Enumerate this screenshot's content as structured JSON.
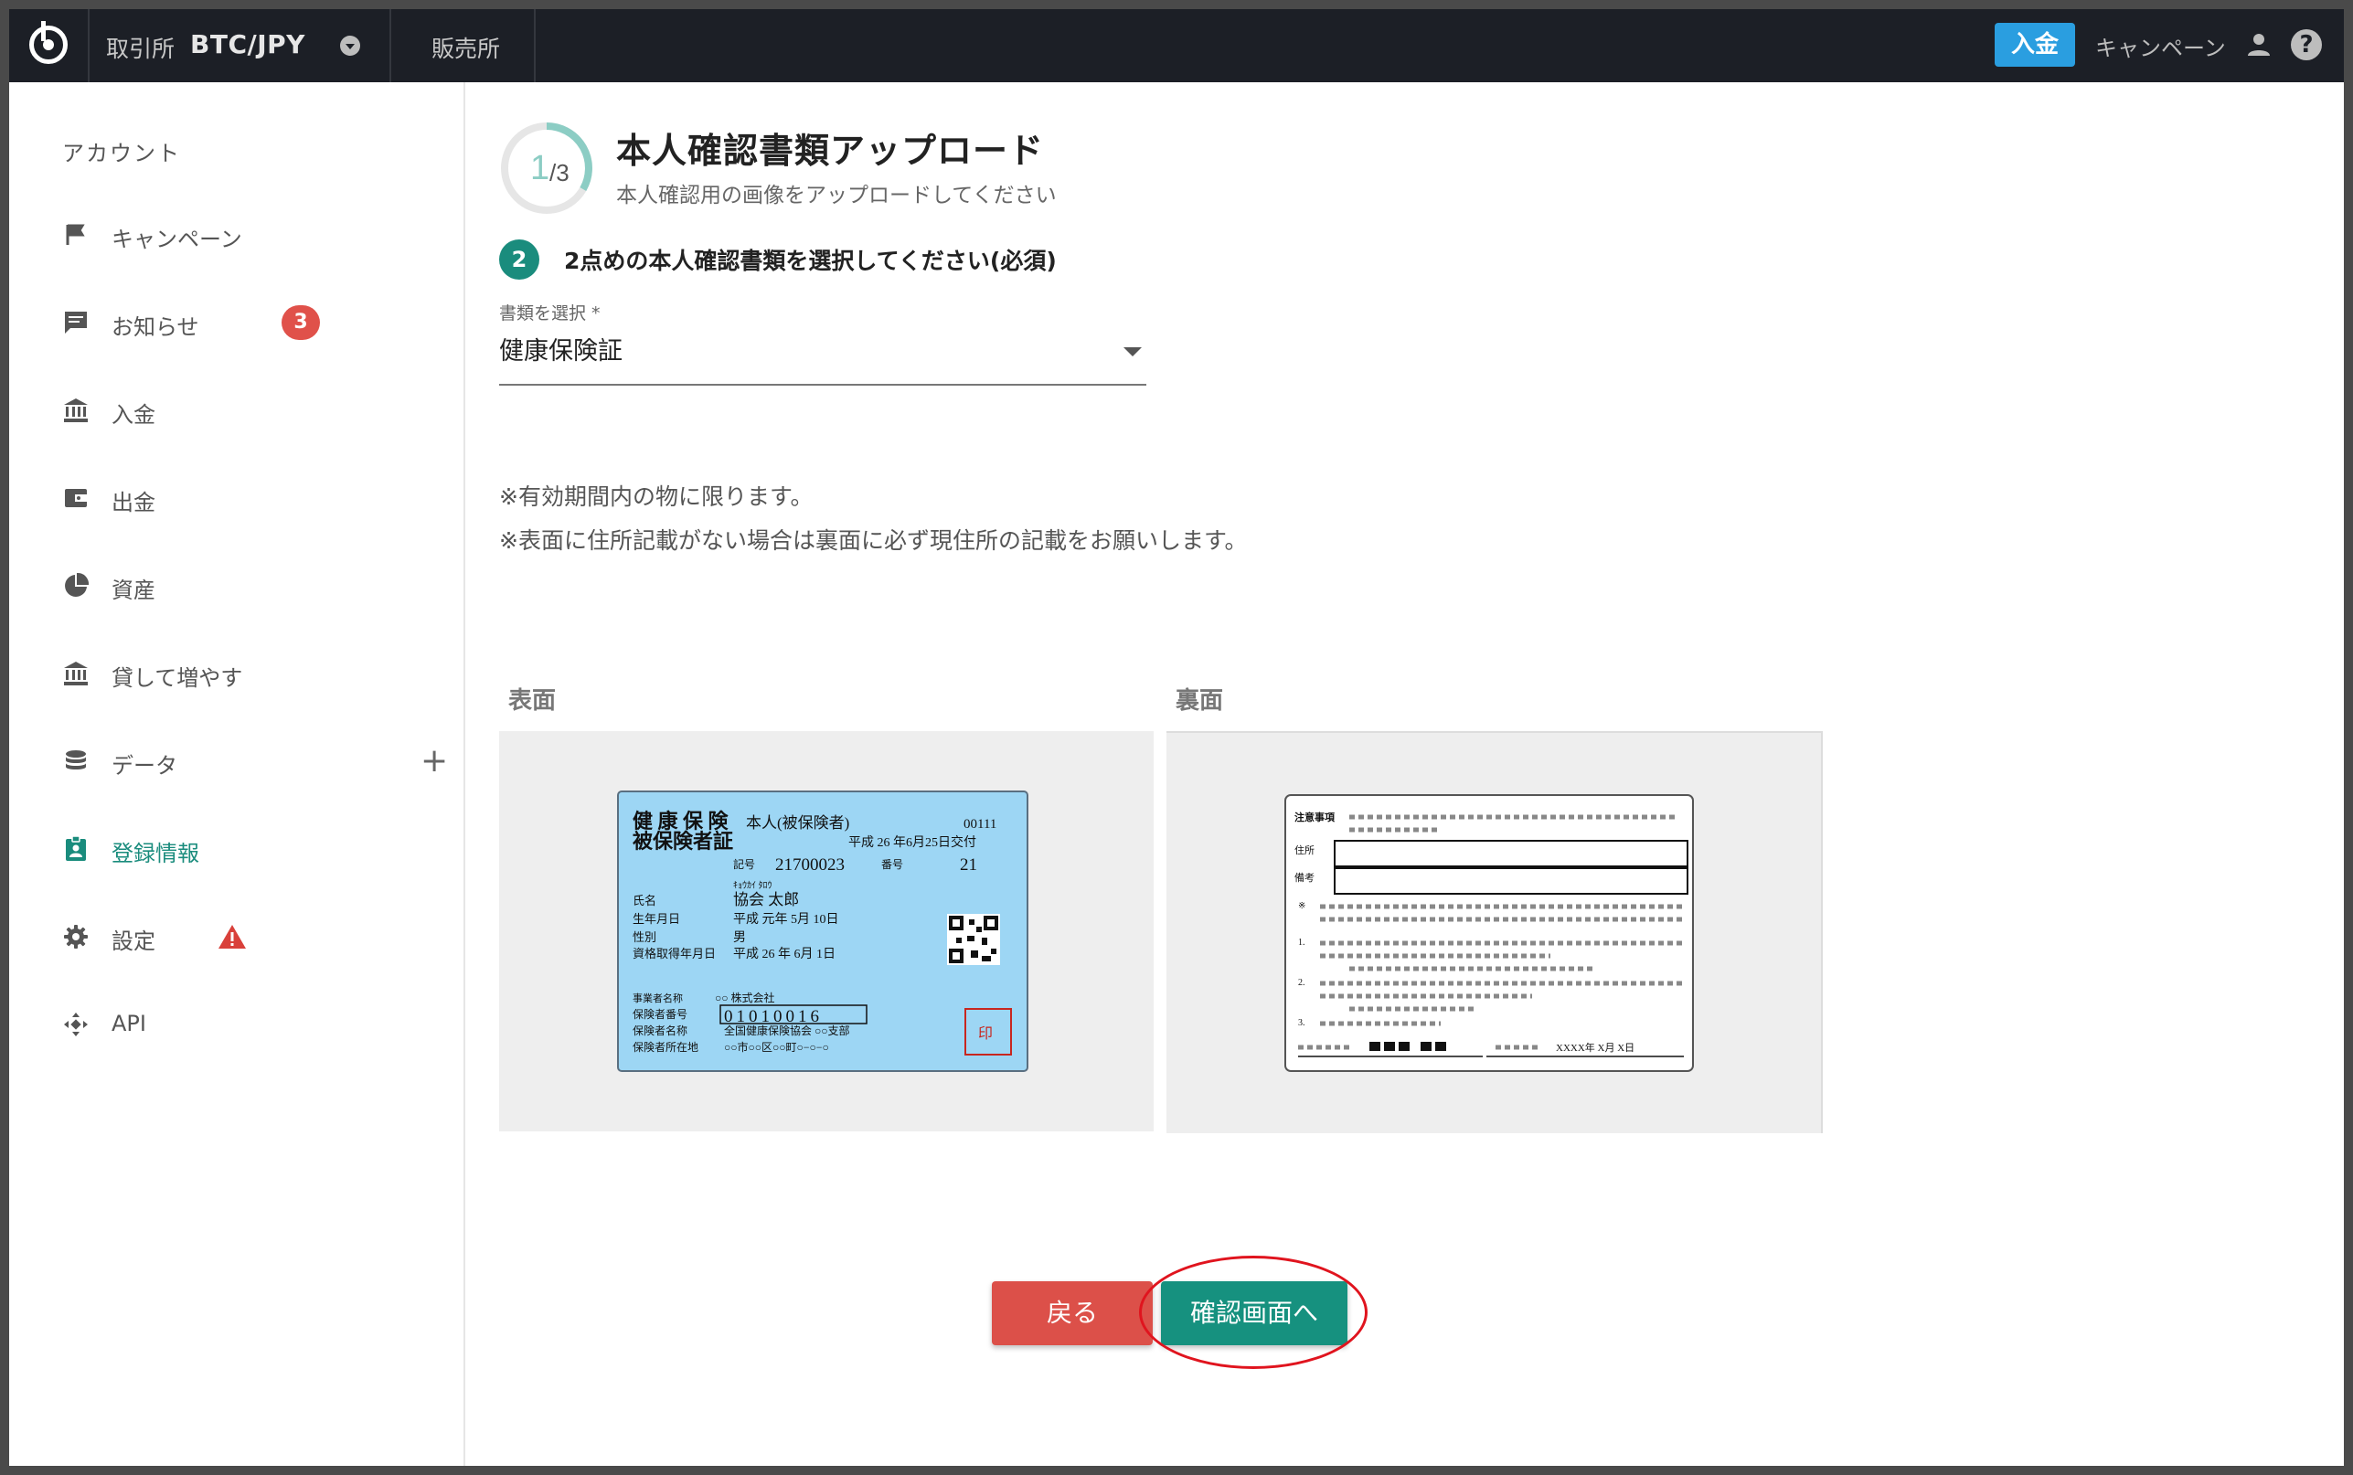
{
  "topbar": {
    "exchange_label": "取引所",
    "pair": "BTC/JPY",
    "store_label": "販売所",
    "deposit_button": "入金",
    "campaign_link": "キャンペーン",
    "help_icon_glyph": "?"
  },
  "sidebar": {
    "title": "アカウント",
    "items": [
      {
        "label": "キャンペーン",
        "icon": "flag-icon"
      },
      {
        "label": "お知らせ",
        "icon": "message-icon",
        "badge": "3"
      },
      {
        "label": "入金",
        "icon": "bank-icon"
      },
      {
        "label": "出金",
        "icon": "wallet-icon"
      },
      {
        "label": "資産",
        "icon": "pie-chart-icon"
      },
      {
        "label": "貸して増やす",
        "icon": "bank-icon"
      },
      {
        "label": "データ",
        "icon": "database-icon",
        "expand": "+"
      },
      {
        "label": "登録情報",
        "icon": "id-badge-icon",
        "active": true
      },
      {
        "label": "設定",
        "icon": "gear-icon",
        "warning": true
      },
      {
        "label": "API",
        "icon": "api-icon"
      }
    ]
  },
  "main": {
    "progress": {
      "current": "1",
      "total": "/3",
      "fraction": 0.333
    },
    "title": "本人確認書類アップロード",
    "subtitle": "本人確認用の画像をアップロードしてください",
    "step_number": "2",
    "step_text": "2点めの本人確認書類を選択してください(必須)",
    "select": {
      "label": "書類を選択 *",
      "value": "健康保険証"
    },
    "notes": [
      "※有効期間内の物に限ります。",
      "※表面に住所記載がない場合は裏面に必ず現住所の記載をお願いします。"
    ],
    "front_label": "表面",
    "back_label": "裏面",
    "front_card": {
      "title_line1": "健 康 保 険",
      "title_line2": "被保険者証",
      "holder": "本人(被保険者)",
      "code": "00111",
      "issued": "平成 26 年6月25日交付",
      "kigo_label": "記号",
      "kigo": "21700023",
      "bango_label": "番号",
      "bango": "21",
      "furigana": "ｷｮｳｶｲ  ﾀﾛｳ",
      "name_label": "氏名",
      "name": "協会  太郎",
      "birth_label": "生年月日",
      "birth": "平成  元年   5月 10日",
      "sex_label": "性別",
      "sex": "男",
      "acq_label": "資格取得年月日",
      "acq": "平成  26 年   6月   1日",
      "biz_label": "事業者名称",
      "biz": "○○  株式会社",
      "insurer_no_label": "保険者番号",
      "insurer_no": "01010016",
      "insurer_name_label": "保険者名称",
      "insurer_name": "全国健康保険協会  ○○支部",
      "insurer_addr_label": "保険者所在地",
      "insurer_addr": "○○市○○区○○町○−○−○",
      "seal": "印"
    },
    "back_card": {
      "notice_label": "注意事項",
      "address_label": "住所",
      "remarks_label": "備考",
      "mark": "※",
      "n1": "1.",
      "n2": "2.",
      "n3": "3.",
      "date_text": "XXXX年  X月    X日"
    },
    "back_button": "戻る",
    "confirm_button": "確認画面へ"
  },
  "colors": {
    "accent": "#1a8c7d",
    "deposit": "#2a9ee0",
    "danger": "#dc5049",
    "card_blue": "#9dd6f4",
    "highlight": "#e0141e"
  }
}
